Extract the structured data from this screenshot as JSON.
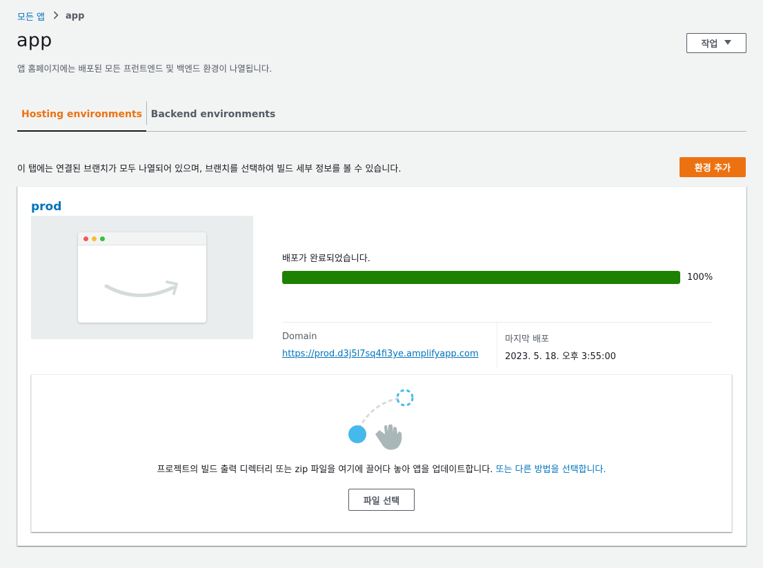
{
  "breadcrumb": {
    "root": "모든 앱",
    "separator": ">",
    "current": "app"
  },
  "header": {
    "title": "app",
    "description": "앱 홈페이지에는 배포된 모든 프런트엔드 및 백엔드 환경이 나열됩니다.",
    "actions_label": "작업",
    "actions_icon": "caret-down-icon"
  },
  "tabs": [
    {
      "label": "Hosting environments",
      "active": true
    },
    {
      "label": "Backend environments",
      "active": false
    }
  ],
  "hosting": {
    "info": "이 탭에는 연결된 브랜치가 모두 나열되어 있으며, 브랜치를 선택하여 빌드 세부 정보를 볼 수 있습니다.",
    "add_env_label": "환경 추가"
  },
  "branch": {
    "name": "prod",
    "deploy_status": "배포가 완료되었습니다.",
    "progress_percent": 100,
    "progress_label": "100%",
    "domain_label": "Domain",
    "domain_url": "https://prod.d3j5l7sq4fi3ye.amplifyapp.com",
    "last_deploy_label": "마지막 배포",
    "last_deploy_value": "2023. 5. 18. 오후 3:55:00"
  },
  "dropzone": {
    "text": "프로젝트의 빌드 출력 디렉터리 또는 zip 파일을 여기에 끌어다 놓아 앱을 업데이트합니다. ",
    "link": "또는 다른 방법을 선택합니다.",
    "button_label": "파일 선택",
    "illustration_icon": "drag-drop-hand-icon"
  },
  "colors": {
    "accent": "#ec7211",
    "link": "#0073bb",
    "success": "#1d8102",
    "text": "#16191f",
    "muted": "#545b64"
  }
}
